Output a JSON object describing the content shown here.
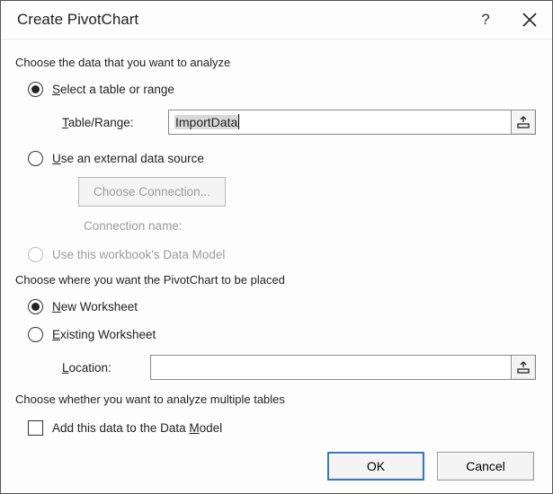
{
  "title": "Create PivotChart",
  "section1": {
    "heading": "Choose the data that you want to analyze",
    "opt_select": {
      "prefix": "S",
      "rest": "elect a table or range",
      "checked": true
    },
    "table_range": {
      "label_prefix": "T",
      "label_rest": "able/Range:",
      "value": "ImportData"
    },
    "opt_external": {
      "prefix": "U",
      "rest": "se an external data source",
      "checked": false
    },
    "choose_connection_label": "Choose Connection...",
    "connection_name_label": "Connection name:",
    "opt_datamodel": {
      "text": "Use this workbook's Data Model",
      "checked": false,
      "disabled": true
    }
  },
  "section2": {
    "heading": "Choose where you want the PivotChart to be placed",
    "opt_new": {
      "prefix": "N",
      "rest": "ew Worksheet",
      "checked": true
    },
    "opt_existing": {
      "prefix": "E",
      "rest": "xisting Worksheet",
      "checked": false
    },
    "location": {
      "label_prefix": "L",
      "label_rest": "ocation:",
      "value": ""
    }
  },
  "section3": {
    "heading": "Choose whether you want to analyze multiple tables",
    "add_to_model": {
      "pre": "Add this data to the Data ",
      "ul": "M",
      "post": "odel",
      "checked": false
    }
  },
  "buttons": {
    "ok": "OK",
    "cancel": "Cancel"
  }
}
